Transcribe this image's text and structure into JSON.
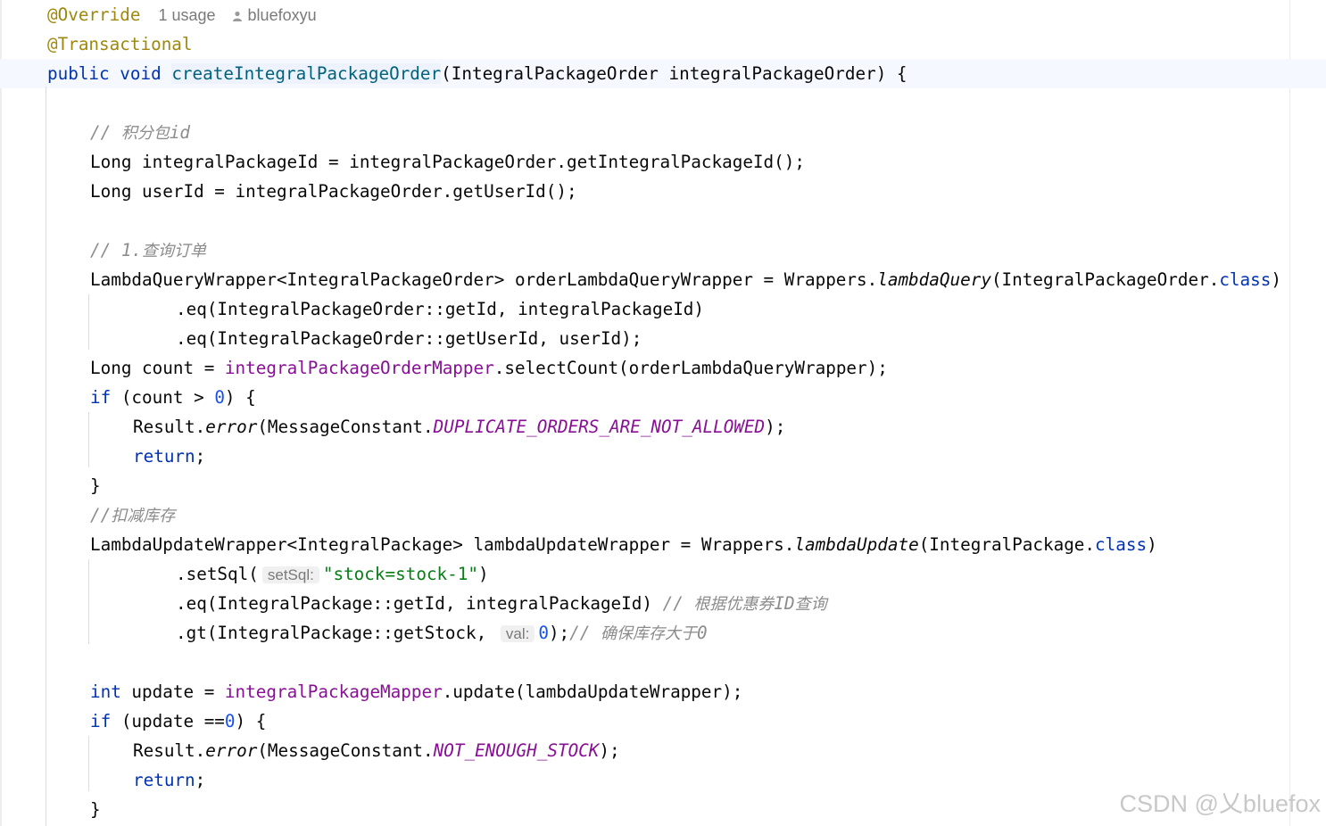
{
  "header": {
    "annotation_override": "@Override",
    "usages": "1 usage",
    "author": "bluefoxyu",
    "annotation_transactional": "@Transactional"
  },
  "code": {
    "l3": {
      "public": "public",
      "void": "void",
      "method": "createIntegralPackageOrder",
      "params": "(IntegralPackageOrder integralPackageOrder) {"
    },
    "l5": {
      "comment_prefix": "// ",
      "comment_cjk": "积分包",
      "comment_suffix": "id"
    },
    "l6": "Long integralPackageId = integralPackageOrder.getIntegralPackageId();",
    "l7": "Long userId = integralPackageOrder.getUserId();",
    "l9": {
      "comment_prefix": "// 1.",
      "comment_cjk": "查询订单"
    },
    "l10": {
      "a": "LambdaQueryWrapper<IntegralPackageOrder> orderLambdaQueryWrapper = Wrappers.",
      "b": "lambdaQuery",
      "c": "(IntegralPackageOrder.",
      "d": "class",
      "e": ")"
    },
    "l11": ".eq(IntegralPackageOrder::getId, integralPackageId)",
    "l12": ".eq(IntegralPackageOrder::getUserId, userId);",
    "l13": {
      "a": "Long count = ",
      "b": "integralPackageOrderMapper",
      "c": ".selectCount(orderLambdaQueryWrapper);"
    },
    "l14": {
      "a": "if",
      "b": " (count > ",
      "c": "0",
      "d": ") {"
    },
    "l15": {
      "a": "Result.",
      "b": "error",
      "c": "(MessageConstant.",
      "d": "DUPLICATE_ORDERS_ARE_NOT_ALLOWED",
      "e": ");"
    },
    "l16": {
      "a": "return",
      "b": ";"
    },
    "l17": "}",
    "l18": {
      "comment_prefix": "//",
      "comment_cjk": "扣减库存"
    },
    "l19": {
      "a": "LambdaUpdateWrapper<IntegralPackage> lambdaUpdateWrapper = Wrappers.",
      "b": "lambdaUpdate",
      "c": "(IntegralPackage.",
      "d": "class",
      "e": ")"
    },
    "l20": {
      "a": ".setSql(",
      "hint": "setSql:",
      "b": "\"stock=stock-1\"",
      "c": ")"
    },
    "l21": {
      "a": ".eq(IntegralPackage::getId, integralPackageId) ",
      "b": "// ",
      "cjk1": "根据优惠券",
      "c": "ID",
      "cjk2": "查询"
    },
    "l22": {
      "a": ".gt(IntegralPackage::getStock, ",
      "hint": "val:",
      "b": "0",
      "c": ");",
      "d": "// ",
      "cjk": "确保库存大于",
      "e": "0"
    },
    "l24": {
      "a": "int",
      "b": " update = ",
      "c": "integralPackageMapper",
      "d": ".update(lambdaUpdateWrapper);"
    },
    "l25": {
      "a": "if",
      "b": " (update ==",
      "c": "0",
      "d": ") {"
    },
    "l26": {
      "a": "Result.",
      "b": "error",
      "c": "(MessageConstant.",
      "d": "NOT_ENOUGH_STOCK",
      "e": ");"
    },
    "l27": {
      "a": "return",
      "b": ";"
    },
    "l28": "}"
  },
  "watermark": "CSDN @乂bluefox"
}
